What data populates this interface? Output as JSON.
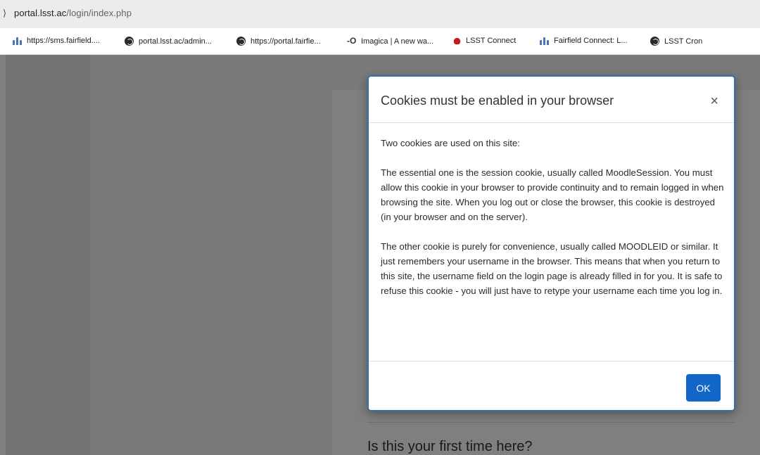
{
  "browser": {
    "url_host": "portal.lsst.ac",
    "url_path": "/login/index.php",
    "bookmarks": [
      {
        "label": "https://sms.fairfield....",
        "icon": "people-icon"
      },
      {
        "label": "portal.lsst.ac/admin...",
        "icon": "globe-icon"
      },
      {
        "label": "https://portal.fairfie...",
        "icon": "globe-icon"
      },
      {
        "label": "Imagica | A new wa...",
        "icon": "imagica-icon"
      },
      {
        "label": "LSST Connect",
        "icon": "lsst-icon"
      },
      {
        "label": "Fairfield Connect: L...",
        "icon": "people-icon"
      },
      {
        "label": "LSST Cron",
        "icon": "globe-icon"
      }
    ]
  },
  "page": {
    "first_time_heading": "Is this your first time here?"
  },
  "modal": {
    "title": "Cookies must be enabled in your browser",
    "close_symbol": "×",
    "paragraphs": [
      "Two cookies are used on this site:",
      "The essential one is the session cookie, usually called MoodleSession. You must allow this cookie in your browser to provide continuity and to remain logged in when browsing the site. When you log out or close the browser, this cookie is destroyed (in your browser and on the server).",
      "The other cookie is purely for convenience, usually called MOODLEID or similar. It just remembers your username in the browser. This means that when you return to this site, the username field on the login page is already filled in for you. It is safe to refuse this cookie - you will just have to retype your username each time you log in."
    ],
    "ok_label": "OK"
  },
  "colors": {
    "primary": "#1166c8",
    "modal_border": "#3a6ea8"
  }
}
